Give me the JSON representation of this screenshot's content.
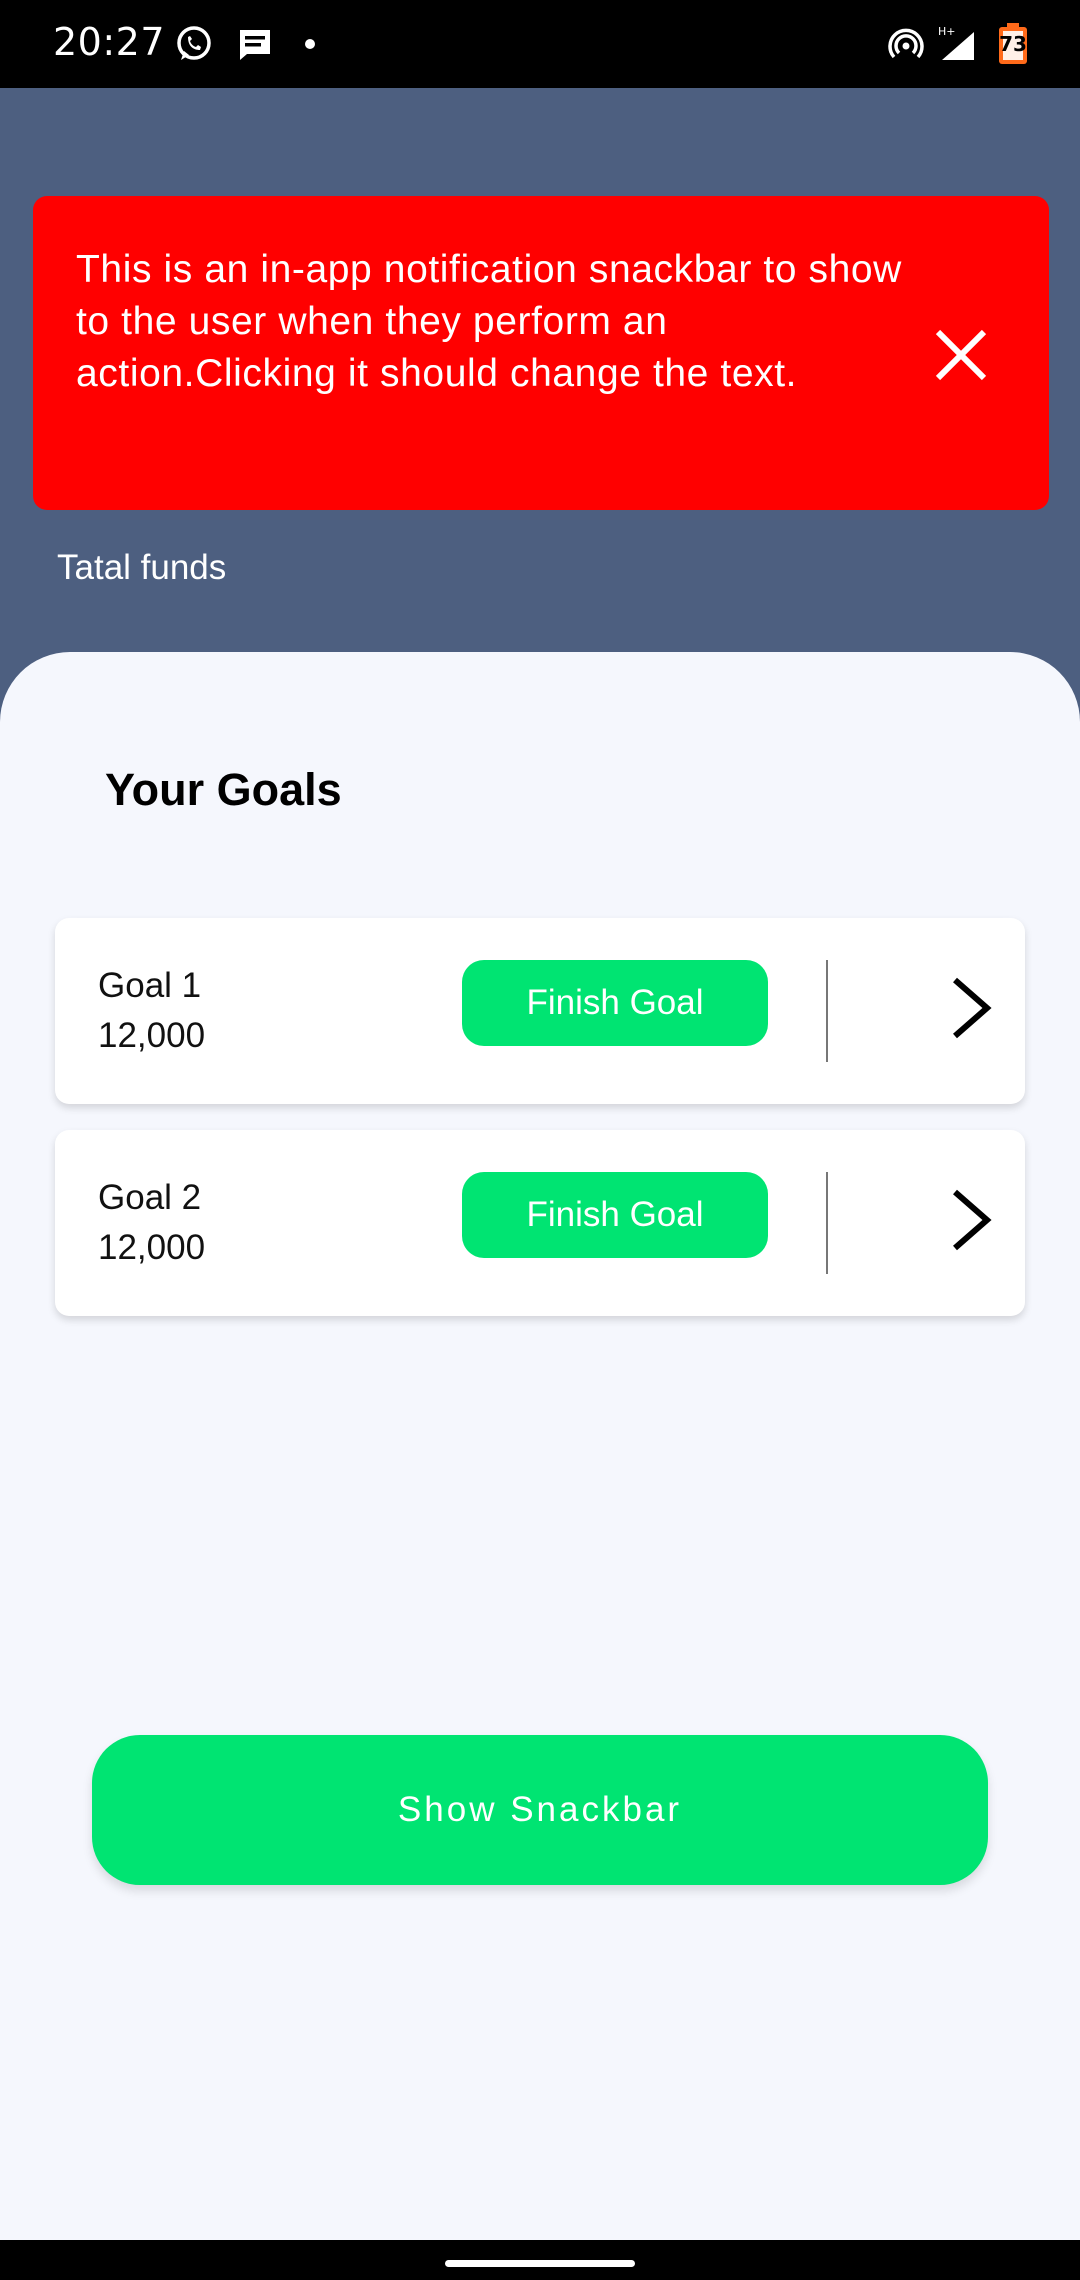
{
  "status_bar": {
    "time": "20:27",
    "battery_level": "73",
    "left_icons": [
      "whatsapp-icon",
      "message-icon",
      "dot-icon"
    ],
    "right_icons": [
      "hotspot-icon",
      "signal-icon",
      "battery-icon"
    ]
  },
  "snackbar": {
    "message": "This is an in-app notification snackbar to show to the user when they perform an action.Clicking it should change the text.",
    "background_color": "#ff0000",
    "close_icon": "close-icon"
  },
  "header": {
    "total_funds_label": "Tatal funds",
    "background_color": "#4d5f80"
  },
  "goals": {
    "title": "Your Goals",
    "items": [
      {
        "name": "Goal 1",
        "amount": "12,000",
        "button_label": "Finish Goal"
      },
      {
        "name": "Goal 2",
        "amount": "12,000",
        "button_label": "Finish Goal"
      }
    ]
  },
  "actions": {
    "show_snackbar_label": "Show Snackbar"
  },
  "colors": {
    "accent": "#00e472",
    "sheet_background": "#f5f7fd"
  }
}
